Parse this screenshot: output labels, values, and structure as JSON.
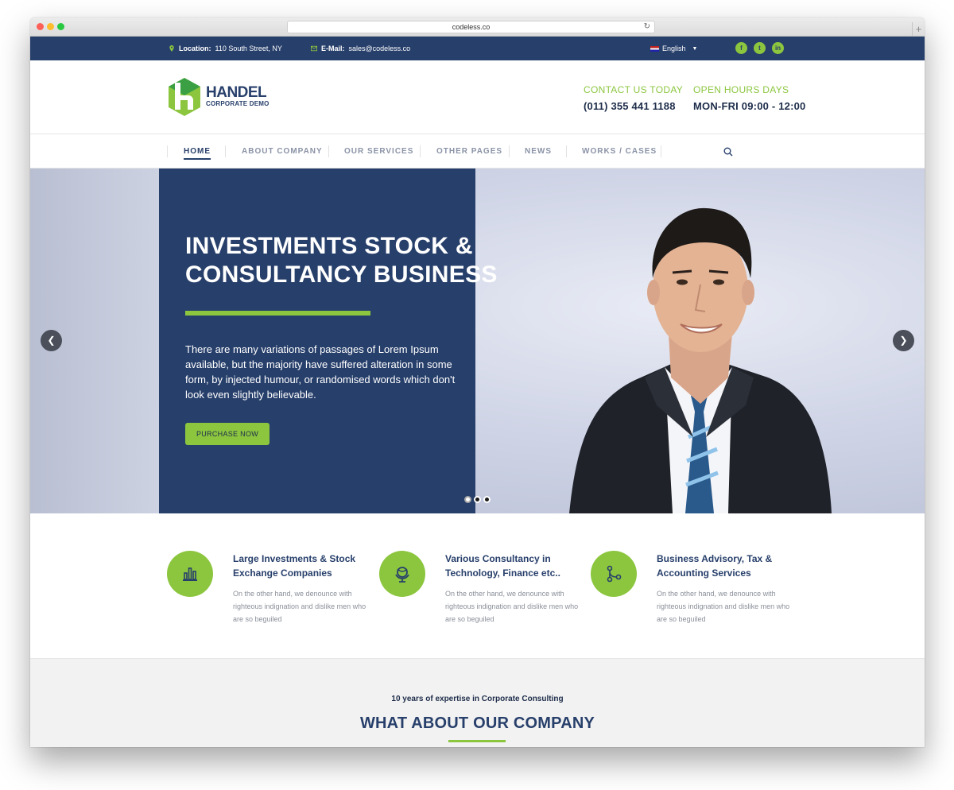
{
  "browser": {
    "url": "codeless.co"
  },
  "topbar": {
    "location_label": "Location:",
    "location_value": "110 South Street, NY",
    "email_label": "E-Mail:",
    "email_value": "sales@codeless.co",
    "language": "English",
    "social": [
      "f",
      "t",
      "in"
    ]
  },
  "header": {
    "logo_name": "HANDEL",
    "logo_sub": "CORPORATE DEMO",
    "contact_label": "CONTACT US TODAY",
    "contact_value": "(011) 355 441 1188",
    "hours_label": "OPEN HOURS DAYS",
    "hours_value": "MON-FRI 09:00 - 12:00"
  },
  "nav": {
    "items": [
      "HOME",
      "ABOUT COMPANY",
      "OUR SERVICES",
      "OTHER PAGES",
      "NEWS",
      "WORKS / CASES"
    ],
    "active": "HOME"
  },
  "hero": {
    "title_line1": "INVESTMENTS STOCK &",
    "title_line2": "CONSULTANCY BUSINESS",
    "text": "There are many variations of passages of Lorem Ipsum available, but the majority have suffered alteration in some form, by injected humour, or randomised words which don't look even slightly believable.",
    "button": "PURCHASE NOW",
    "slide_count": 3,
    "active_slide": 1
  },
  "features": [
    {
      "icon": "chart-icon",
      "title": "Large Investments & Stock Exchange Companies",
      "text": "On the other hand, we denounce with righteous indignation and dislike men who are so beguiled"
    },
    {
      "icon": "globe-icon",
      "title": "Various Consultancy in Technology, Finance etc..",
      "text": "On the other hand, we denounce with righteous indignation and dislike men who are so beguiled"
    },
    {
      "icon": "flow-icon",
      "title": "Business Advisory, Tax & Accounting Services",
      "text": "On the other hand, we denounce with righteous indignation and dislike men who are so beguiled"
    }
  ],
  "about": {
    "subtitle": "10 years of expertise in Corporate Consulting",
    "title": "WHAT ABOUT OUR COMPANY"
  },
  "colors": {
    "navy": "#273f6b",
    "green": "#8cc63f"
  }
}
